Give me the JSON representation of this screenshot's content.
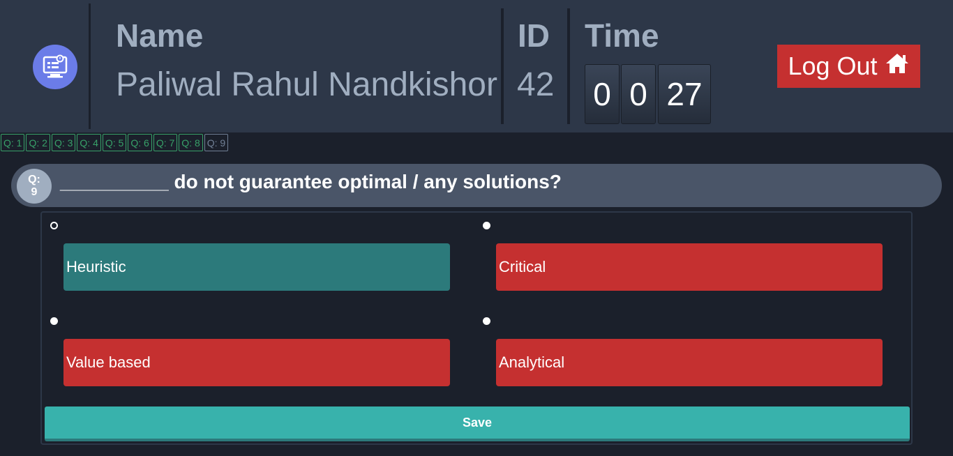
{
  "header": {
    "name_label": "Name",
    "name_value": "Paliwal Rahul Nandkishor",
    "id_label": "ID",
    "id_value": "42",
    "time_label": "Time",
    "time_hours": "0",
    "time_minutes": "0",
    "time_seconds": "27",
    "logout_label": "Log Out",
    "logo_icon": "computer-exam-icon",
    "logout_icon": "home-icon"
  },
  "question_nav": [
    {
      "label": "Q: 1",
      "status": "answered"
    },
    {
      "label": "Q: 2",
      "status": "answered"
    },
    {
      "label": "Q: 3",
      "status": "answered"
    },
    {
      "label": "Q: 4",
      "status": "answered"
    },
    {
      "label": "Q: 5",
      "status": "answered"
    },
    {
      "label": "Q: 6",
      "status": "answered"
    },
    {
      "label": "Q: 7",
      "status": "answered"
    },
    {
      "label": "Q: 8",
      "status": "answered"
    },
    {
      "label": "Q: 9",
      "status": "current"
    }
  ],
  "question": {
    "badge_prefix": "Q:",
    "badge_number": "9",
    "text": "__________ do not guarantee optimal / any solutions?"
  },
  "options": [
    {
      "label": "Heuristic",
      "state": "correct",
      "selected": true
    },
    {
      "label": "Critical",
      "state": "wrong",
      "selected": false
    },
    {
      "label": "Value based",
      "state": "wrong",
      "selected": false
    },
    {
      "label": "Analytical",
      "state": "wrong",
      "selected": false
    }
  ],
  "save_label": "Save",
  "colors": {
    "header_bg": "#2d3748",
    "page_bg": "#1b202b",
    "accent": "#6b7ce8",
    "danger": "#c53030",
    "correct": "#2c7a7b",
    "success": "#38a169",
    "save": "#38b2ac"
  }
}
